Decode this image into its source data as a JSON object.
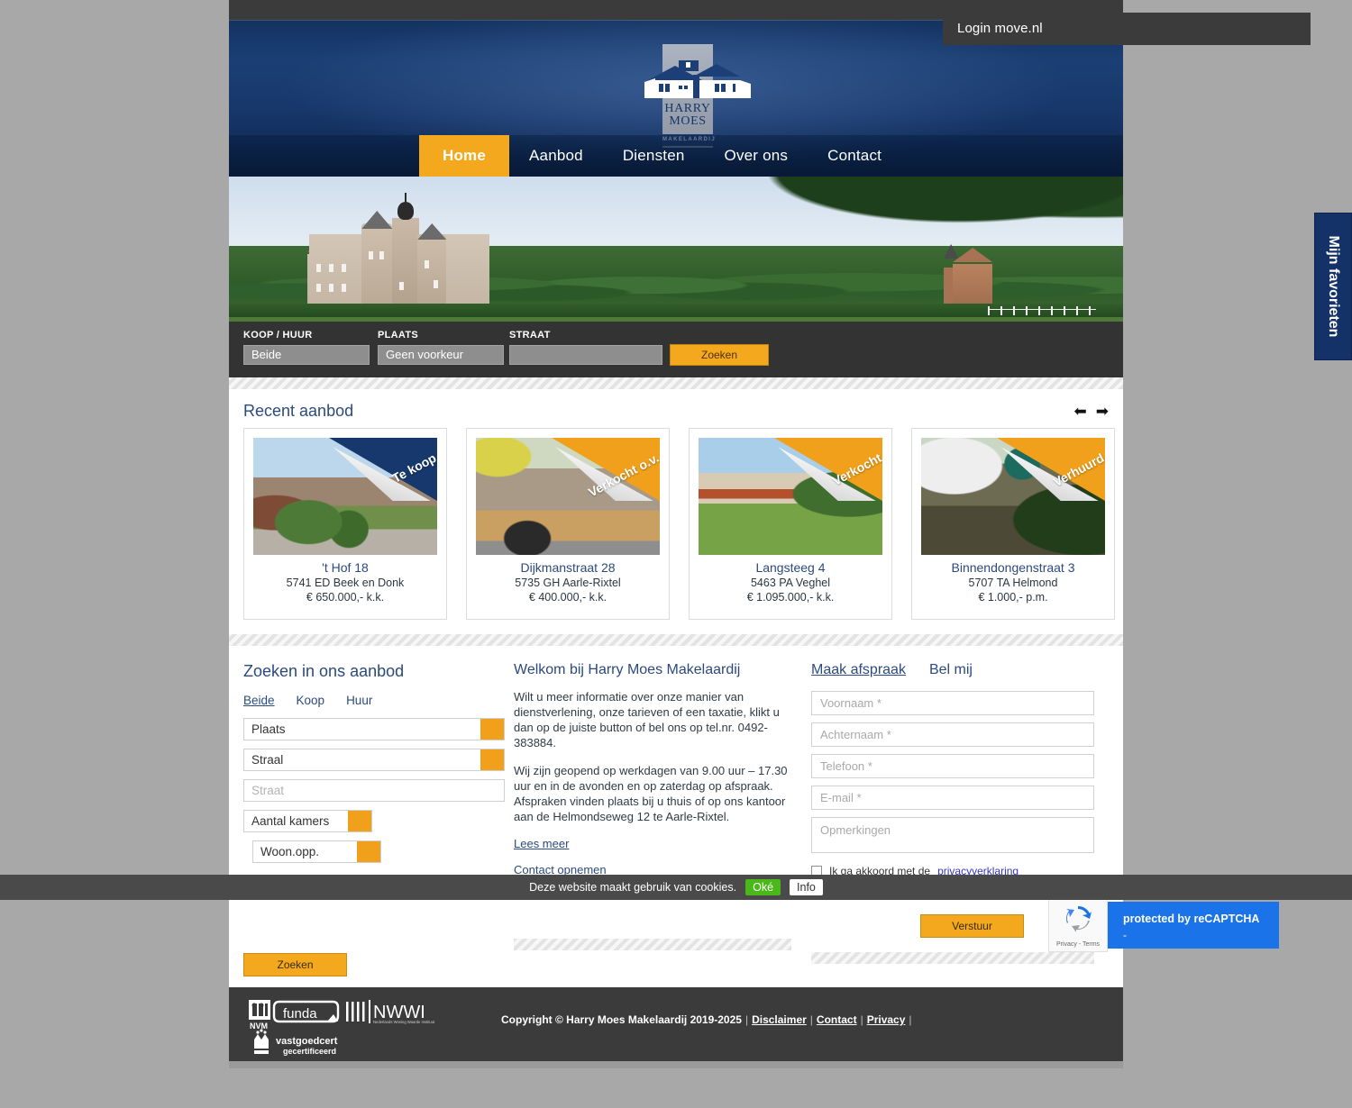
{
  "topbar": {
    "login_label": "Login move.nl"
  },
  "brand": {
    "name_line1": "HARRY",
    "name_line2": "MOES",
    "tagline": "MAKELAARDIJ",
    "accent": "#f4a81d",
    "navy": "#16386c"
  },
  "nav": {
    "items": [
      {
        "label": "Home",
        "active": true
      },
      {
        "label": "Aanbod",
        "active": false
      },
      {
        "label": "Diensten",
        "active": false
      },
      {
        "label": "Over ons",
        "active": false
      },
      {
        "label": "Contact",
        "active": false
      }
    ]
  },
  "quick_search": {
    "labels": {
      "koop_huur": "KOOP / HUUR",
      "plaats": "PLAATS",
      "straat": "STRAAT"
    },
    "values": {
      "koop_huur": "Beide",
      "plaats": "Geen voorkeur",
      "straat": ""
    },
    "button": "Zoeken"
  },
  "recent": {
    "title": "Recent aanbod",
    "prev_icon": "arrow-left-icon",
    "next_icon": "arrow-right-icon",
    "cards": [
      {
        "ribbon": "Te koop",
        "ribbon_color": "#16386c",
        "address": "'t Hof 18",
        "zip_city": "5741 ED Beek en Donk",
        "price": "€ 650.000,- k.k."
      },
      {
        "ribbon": "Verkocht o.v.",
        "ribbon_color": "#f0a01b",
        "address": "Dijkmanstraat 28",
        "zip_city": "5735 GH Aarle-Rixtel",
        "price": "€ 400.000,- k.k."
      },
      {
        "ribbon": "Verkocht",
        "ribbon_color": "#f0a01b",
        "address": "Langsteeg 4",
        "zip_city": "5463 PA Veghel",
        "price": "€ 1.095.000,- k.k."
      },
      {
        "ribbon": "Verhuurd",
        "ribbon_color": "#f0a01b",
        "address": "Binnendongenstraat 3",
        "zip_city": "5707 TA Helmond",
        "price": "€ 1.000,- p.m."
      }
    ]
  },
  "search_panel": {
    "title": "Zoeken in ons aanbod",
    "tabs": [
      {
        "label": "Beide",
        "active": true
      },
      {
        "label": "Koop",
        "active": false
      },
      {
        "label": "Huur",
        "active": false
      }
    ],
    "fields": {
      "plaats_value": "Plaats",
      "straal_value": "Straal",
      "straat_placeholder": "Straat",
      "kamers_value": "Aantal kamers",
      "woonopp_value": "Woon.opp."
    },
    "button": "Zoeken"
  },
  "welcome": {
    "title": "Welkom bij Harry Moes Makelaardij",
    "paragraph1": "Wilt u meer informatie over onze manier van dienstverlening, onze tarieven of een taxatie, klikt u dan op de juiste button of bel ons op tel.nr. 0492-383884.",
    "paragraph2": "Wij zijn geopend op werkdagen van 9.00 uur – 17.30 uur en in de avonden en op zaterdag op afspraak. Afspraken vinden plaats bij u thuis of op ons kantoor aan de Helmondseweg 12 te Aarle-Rixtel.",
    "link_more": "Lees meer",
    "link_contact": "Contact opnemen"
  },
  "contact_form": {
    "tabs": [
      {
        "label": "Maak afspraak",
        "active": true
      },
      {
        "label": "Bel mij",
        "active": false
      }
    ],
    "placeholders": {
      "voornaam": "Voornaam *",
      "achternaam": "Achternaam *",
      "telefoon": "Telefoon *",
      "email": "E-mail *",
      "opmerkingen": "Opmerkingen"
    },
    "consent_text": "Ik ga akkoord met de",
    "consent_link": "privacyverklaring",
    "button": "Verstuur"
  },
  "cookie_bar": {
    "text": "Deze website maakt gebruik van cookies.",
    "accept": "Oké",
    "info": "Info"
  },
  "recaptcha": {
    "badge_text": "protected by reCAPTCHA",
    "dash": "-",
    "privacy_terms": "Privacy - Terms"
  },
  "favorites": {
    "label": "Mijn favorieten"
  },
  "footer": {
    "logos": [
      "NVM",
      "funda",
      "NWWI",
      "Nederlands Woning Waarde Instituut",
      "vastgoedcert",
      "gecertificeerd"
    ],
    "copyright": "Copyright © Harry Moes Makelaardij 2019-2025",
    "links": [
      {
        "label": "Disclaimer"
      },
      {
        "label": "Contact"
      },
      {
        "label": "Privacy"
      }
    ]
  }
}
